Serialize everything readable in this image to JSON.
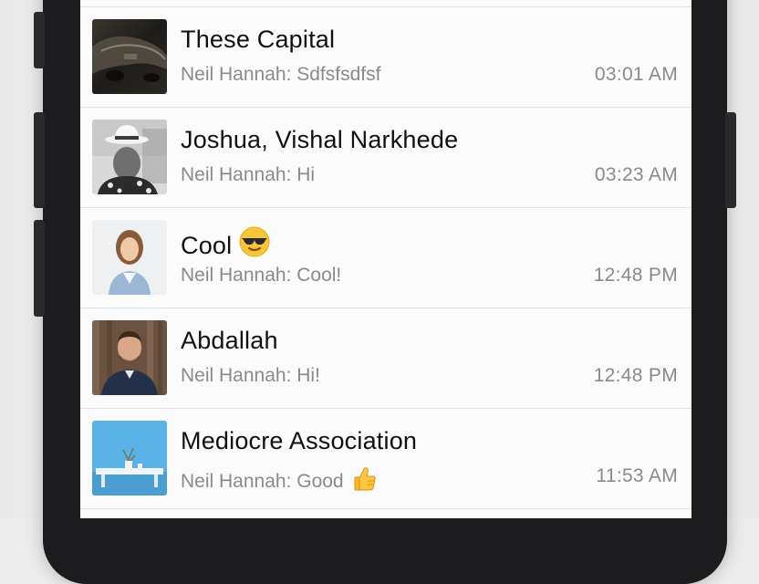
{
  "chats": [
    {
      "title": "These Capital",
      "title_emoji": "",
      "preview": "Neil Hannah: Sdfsfsdfsf",
      "preview_emoji": "",
      "time": "03:01 AM",
      "avatar_icon": "car-photo"
    },
    {
      "title": "Joshua, Vishal Narkhede",
      "title_emoji": "",
      "preview": "Neil Hannah: Hi",
      "preview_emoji": "",
      "time": "03:23 AM",
      "avatar_icon": "man-with-hat-photo"
    },
    {
      "title": "Cool",
      "title_emoji": "sunglasses-emoji",
      "preview": "Neil Hannah: Cool!",
      "preview_emoji": "",
      "time": "12:48 PM",
      "avatar_icon": "woman-portrait-photo"
    },
    {
      "title": "Abdallah",
      "title_emoji": "",
      "preview": "Neil Hannah: Hi!",
      "preview_emoji": "",
      "time": "12:48 PM",
      "avatar_icon": "man-portrait-photo"
    },
    {
      "title": "Mediocre Association",
      "title_emoji": "",
      "preview": "Neil Hannah: Good",
      "preview_emoji": "thumbs-up-emoji",
      "time": "11:53 AM",
      "avatar_icon": "blue-room-photo"
    }
  ],
  "colors": {
    "background": "#fbfbfb",
    "title_text": "#111111",
    "secondary_text": "#8a8a8e",
    "separator": "#e3e3e3",
    "device_frame": "#1c1c1e"
  }
}
